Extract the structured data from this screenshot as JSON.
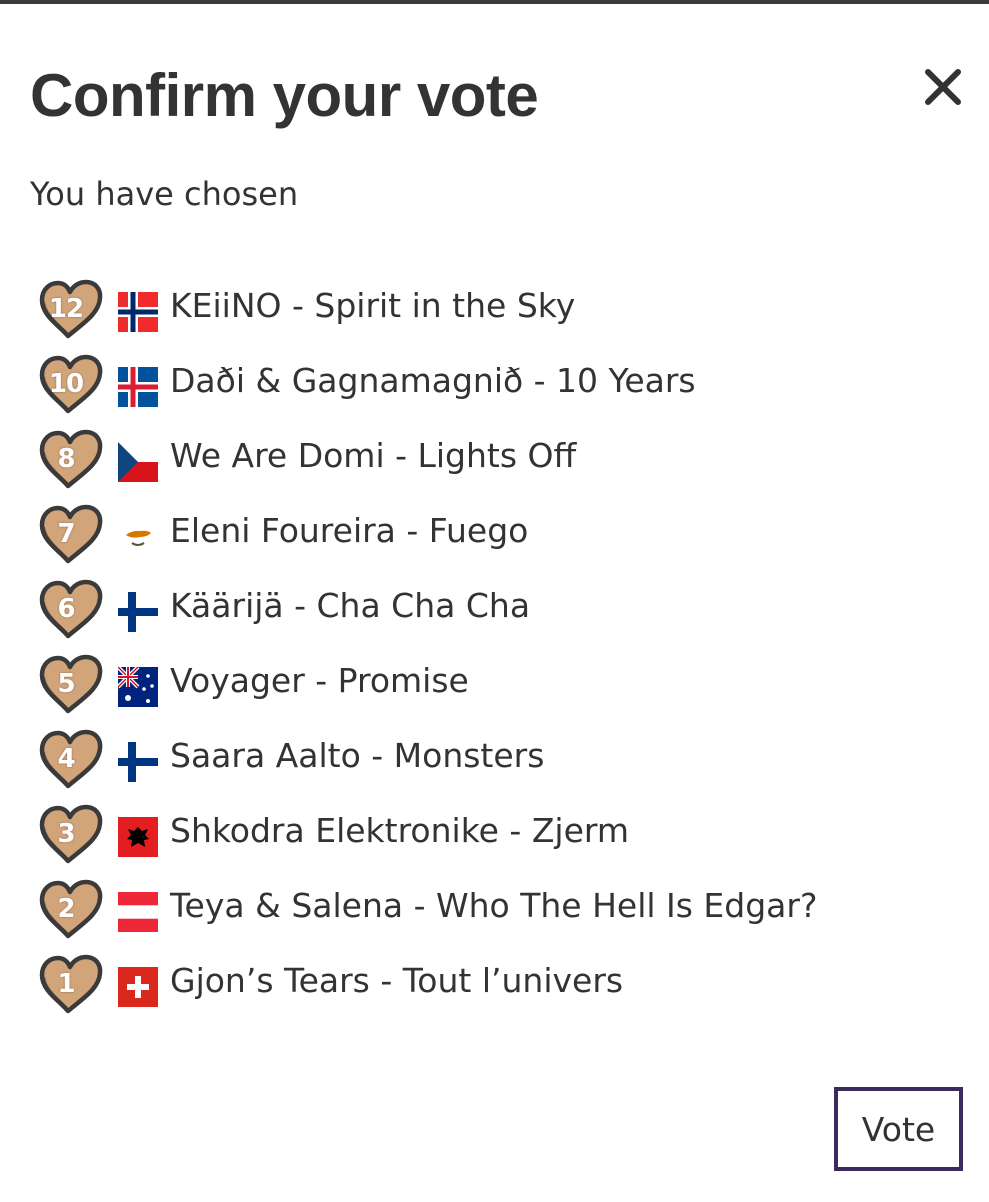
{
  "dialog": {
    "title": "Confirm your vote",
    "subtitle": "You have chosen",
    "close_icon": "close-icon",
    "vote_label": "Vote"
  },
  "colors": {
    "heart_fill": "#d2a47a",
    "heart_outline": "#3a3a3a",
    "vote_border": "#3b2a5c",
    "text": "#333333"
  },
  "votes": [
    {
      "points": "12",
      "flag": "norway-flag",
      "entry": "KEiiNO - Spirit in the Sky"
    },
    {
      "points": "10",
      "flag": "iceland-flag",
      "entry": "Daði & Gagnamagnið - 10 Years"
    },
    {
      "points": "8",
      "flag": "czech-republic-flag",
      "entry": "We Are Domi - Lights Off"
    },
    {
      "points": "7",
      "flag": "cyprus-flag",
      "entry": "Eleni Foureira - Fuego"
    },
    {
      "points": "6",
      "flag": "finland-flag",
      "entry": "Käärijä - Cha Cha Cha"
    },
    {
      "points": "5",
      "flag": "australia-flag",
      "entry": "Voyager - Promise"
    },
    {
      "points": "4",
      "flag": "finland-flag",
      "entry": "Saara Aalto - Monsters"
    },
    {
      "points": "3",
      "flag": "albania-flag",
      "entry": "Shkodra Elektronike - Zjerm"
    },
    {
      "points": "2",
      "flag": "austria-flag",
      "entry": "Teya & Salena - Who The Hell Is Edgar?"
    },
    {
      "points": "1",
      "flag": "switzerland-flag",
      "entry": "Gjon’s Tears - Tout l’univers"
    }
  ]
}
